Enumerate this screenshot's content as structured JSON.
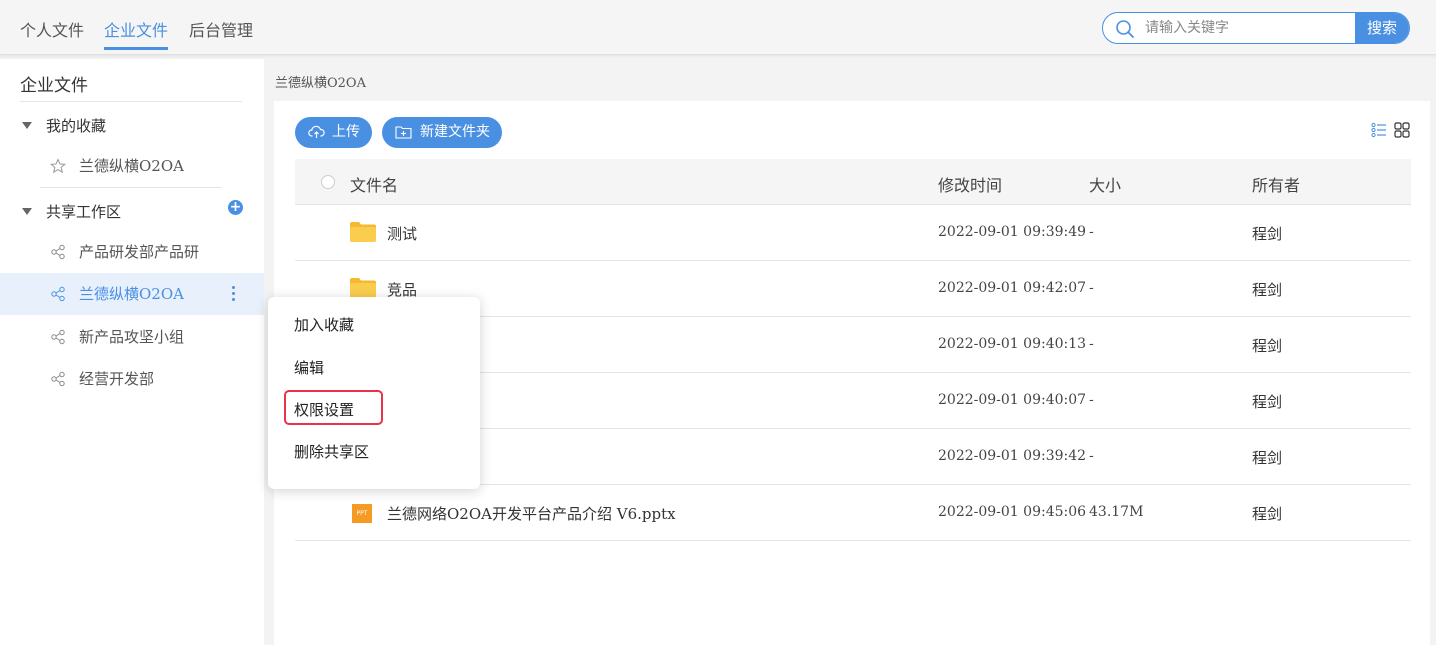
{
  "header": {
    "tabs": [
      {
        "label": "个人文件",
        "active": false
      },
      {
        "label": "企业文件",
        "active": true
      },
      {
        "label": "后台管理",
        "active": false
      }
    ],
    "search": {
      "placeholder": "请输入关键字",
      "button_label": "搜索"
    }
  },
  "sidebar": {
    "title": "企业文件",
    "favorites": {
      "label": "我的收藏",
      "items": [
        {
          "label": "兰德纵横O2OA",
          "icon": "star-icon"
        }
      ]
    },
    "shared": {
      "label": "共享工作区",
      "items": [
        {
          "label": "产品研发部产品研",
          "icon": "share-icon",
          "active": false
        },
        {
          "label": "兰德纵横O2OA",
          "icon": "share-icon",
          "active": true
        },
        {
          "label": "新产品攻坚小组",
          "icon": "share-icon",
          "active": false
        },
        {
          "label": "经营开发部",
          "icon": "share-icon",
          "active": false
        }
      ]
    }
  },
  "breadcrumb": "兰德纵横O2OA",
  "toolbar": {
    "upload_label": "上传",
    "new_folder_label": "新建文件夹"
  },
  "table": {
    "headers": {
      "name": "文件名",
      "modified": "修改时间",
      "size": "大小",
      "owner": "所有者"
    },
    "rows": [
      {
        "name": "测试",
        "type": "folder",
        "modified": "2022-09-01 09:39:49",
        "size": "-",
        "owner": "程剑"
      },
      {
        "name": "竞品",
        "type": "folder",
        "modified": "2022-09-01 09:42:07",
        "size": "-",
        "owner": "程剑"
      },
      {
        "name": "",
        "type": "folder",
        "modified": "2022-09-01 09:40:13",
        "size": "-",
        "owner": "程剑"
      },
      {
        "name": "",
        "type": "folder",
        "modified": "2022-09-01 09:40:07",
        "size": "-",
        "owner": "程剑"
      },
      {
        "name": "",
        "type": "folder",
        "modified": "2022-09-01 09:39:42",
        "size": "-",
        "owner": "程剑"
      },
      {
        "name": "兰德网络O2OA开发平台产品介绍 V6.pptx",
        "type": "ppt",
        "icon_text": "PPT",
        "modified": "2022-09-01 09:45:06",
        "size": "43.17M",
        "owner": "程剑"
      }
    ]
  },
  "context_menu": {
    "items": [
      "加入收藏",
      "编辑",
      "权限设置",
      "删除共享区"
    ],
    "highlighted": "权限设置"
  },
  "colors": {
    "accent": "#4a90e2",
    "highlight_border": "#e8334a",
    "folder": "#f5b82e",
    "ppt": "#f59a23"
  }
}
